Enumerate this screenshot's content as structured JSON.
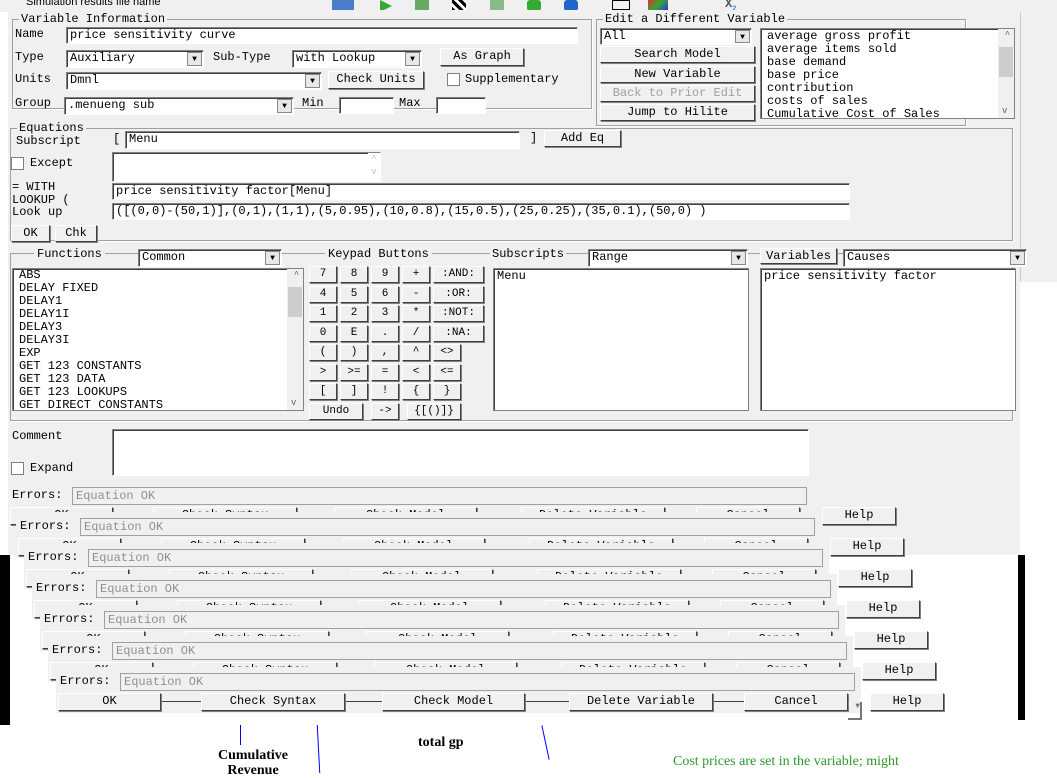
{
  "background": {
    "toolbar_field": "Simulation results file name",
    "diagram_labels": [
      "Cumulative Revenue",
      "total gp",
      "Cost prices are set in the variable; might"
    ]
  },
  "varinfo": {
    "legend": "Variable Information",
    "name_label": "Name",
    "name_value": "price sensitivity curve",
    "type_label": "Type",
    "type_value": "Auxiliary",
    "subtype_label": "Sub-Type",
    "subtype_value": "with Lookup",
    "as_graph": "As Graph",
    "units_label": "Units",
    "units_value": "Dmnl",
    "check_units": "Check Units",
    "supplementary": "Supplementary",
    "supplementary_checked": false,
    "group_label": "Group",
    "group_value": ".menueng sub",
    "min_label": "Min",
    "min_value": "",
    "max_label": "Max",
    "max_value": ""
  },
  "editother": {
    "legend": "Edit a Different Variable",
    "filter": "All",
    "search": "Search Model",
    "new_var": "New Variable",
    "back": "Back to Prior Edit",
    "jump": "Jump to Hilite",
    "variables": [
      "average gross profit",
      "average items sold",
      "base demand",
      "base price",
      "contribution",
      "costs of sales",
      "Cumulative Cost of Sales"
    ]
  },
  "equations": {
    "legend": "Equations",
    "subscript_label": "Subscript",
    "subscript_value": "Menu",
    "add_eq": "Add Eq",
    "except_label": "Except",
    "except_checked": false,
    "with_label": "= WITH",
    "lookup_label": "LOOKUP (",
    "lookup_label2": "Look up",
    "input_value": "price sensitivity factor[Menu]",
    "lookup_value": "([(0,0)-(50,1)],(0,1),(1,1),(5,0.95),(10,0.8),(15,0.5),(25,0.25),(35,0.1),(50,0) )",
    "ok": "OK",
    "chk": "Chk"
  },
  "functions": {
    "label": "Functions",
    "filter": "Common",
    "items": [
      "ABS",
      "DELAY FIXED",
      "DELAY1",
      "DELAY1I",
      "DELAY3",
      "DELAY3I",
      "EXP",
      "GET 123 CONSTANTS",
      "GET 123 DATA",
      "GET 123 LOOKUPS",
      "GET DIRECT CONSTANTS"
    ]
  },
  "keypad": {
    "label": "Keypad Buttons",
    "rows": [
      [
        "7",
        "8",
        "9",
        "+",
        ":AND:"
      ],
      [
        "4",
        "5",
        "6",
        "-",
        ":OR:"
      ],
      [
        "1",
        "2",
        "3",
        "*",
        ":NOT:"
      ],
      [
        "0",
        "E",
        ".",
        "/",
        ":NA:"
      ],
      [
        "(",
        ")",
        ",",
        "^",
        "<>"
      ],
      [
        ">",
        ">=",
        "=",
        "<",
        "<="
      ],
      [
        "[",
        "]",
        "!",
        "{",
        "}"
      ]
    ],
    "last_row": [
      "Undo",
      "->",
      "{[()]}"
    ]
  },
  "subscripts": {
    "label": "Subscripts",
    "filter": "Range",
    "items": [
      "Menu"
    ]
  },
  "variables": {
    "label": "Variables",
    "filter": "Causes",
    "items": [
      "price sensitivity factor"
    ]
  },
  "comment": {
    "label": "Comment",
    "value": "",
    "expand": "Expand",
    "expand_checked": false
  },
  "errors": {
    "label": "Errors:",
    "value": "Equation OK"
  },
  "actions": {
    "ok": "OK",
    "check_syntax": "Check Syntax",
    "check_model": "Check Model",
    "delete": "Delete Variable",
    "cancel": "Cancel",
    "help": "Help"
  }
}
